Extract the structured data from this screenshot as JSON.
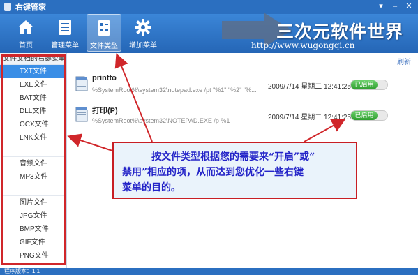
{
  "window": {
    "title": "右键管家",
    "controls": [
      "▾",
      "–",
      "✕"
    ]
  },
  "toolbar": {
    "items": [
      {
        "label": "首页",
        "icon": "home-icon"
      },
      {
        "label": "管理菜单",
        "icon": "menu-list-icon"
      },
      {
        "label": "文件类型",
        "icon": "file-type-icon",
        "active": true
      },
      {
        "label": "增加菜单",
        "icon": "gear-icon"
      }
    ]
  },
  "watermark": {
    "text": "三次元软件世界",
    "url": "http://www.wugongqi.cn"
  },
  "sidebar": {
    "header": "文件文档的右键菜单",
    "group1": [
      "TXT文件",
      "EXE文件",
      "BAT文件",
      "DLL文件",
      "OCX文件",
      "LNK文件"
    ],
    "group2": [
      "音频文件",
      "MP3文件"
    ],
    "group3": [
      "图片文件",
      "JPG文件",
      "BMP文件",
      "GIF文件",
      "PNG文件"
    ],
    "selected": "TXT文件"
  },
  "main": {
    "refresh_label": "刷新",
    "rows": [
      {
        "name": "printto",
        "command": "%SystemRoot%\\system32\\notepad.exe /pt \"%1\" \"%2\" \"%...",
        "date": "2009/7/14 星期二 12:41:25",
        "status": "已启用"
      },
      {
        "name": "打印(P)",
        "command": "%SystemRoot%\\system32\\NOTEPAD.EXE /p %1",
        "date": "2009/7/14 星期二 12:41:25",
        "status": "已启用"
      }
    ]
  },
  "callout": {
    "line1": "按文件类型根据您的需要来“开启”或“",
    "line2": "禁用”相应的项，从而达到您优化一些右键",
    "line3": "菜单的目的。"
  },
  "statusbar": {
    "text": "程序版本：1.1"
  },
  "colors": {
    "titlebar": "#2b6fc0",
    "toolbar": "#2566b6",
    "selected": "#3a8ee6",
    "annotation_red": "#d0262a",
    "callout_text": "#2424c8",
    "toggle_green": "#2e9d2e"
  }
}
